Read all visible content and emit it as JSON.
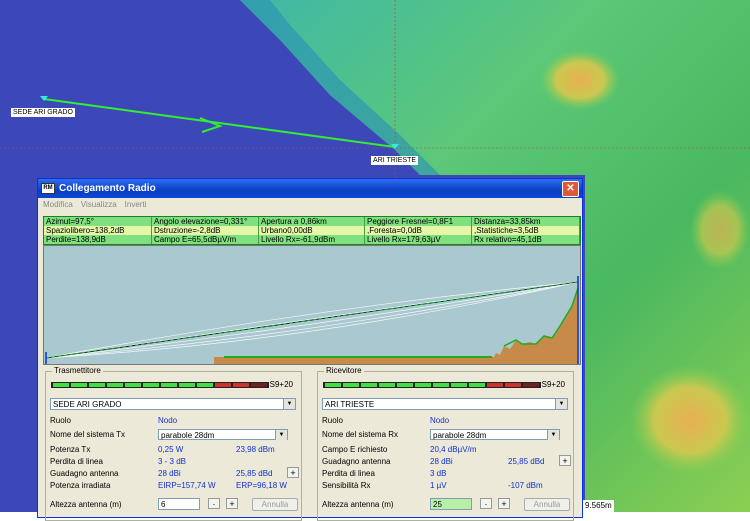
{
  "map": {
    "site_a": "SEDE ARI GRADO",
    "site_b": "ARI TRIESTE",
    "scale": "9.565m"
  },
  "dialog": {
    "title": "Collegamento Radio",
    "menu": [
      "Modifica",
      "Visualizza",
      "Inverti"
    ],
    "stats": [
      [
        "Azimut=97,5°",
        "Angolo elevazione=0,331°",
        "Apertura a 0,86km",
        "Peggiore Fresnel=0,8F1",
        "Distanza=33,85km"
      ],
      [
        "Spaziolibero=138,2dB",
        "Dstruzione=-2,8dB",
        "Urbano0,00dB",
        ",Foresta=0,0dB",
        ",Statistiche=3,5dB"
      ],
      [
        "Perdite=138,9dB",
        "Campo E=65,5dBµV/m",
        "Livello Rx=-61,9dBm",
        "Livello Rx=179,63µV",
        "Rx relativo=45,1dB"
      ]
    ],
    "tx": {
      "title": "Trasmettitore",
      "meter": "S9+20",
      "site": "SEDE ARI GRADO",
      "role_label": "Ruolo",
      "role_value": "Nodo",
      "system_label": "Nome del sistema Tx",
      "system_value": "parabole 28dm",
      "power_label": "Potenza Tx",
      "power_w": "0,25 W",
      "power_dbm": "23,98 dBm",
      "loss_label": "Perdita di linea",
      "loss_value": "3 - 3 dB",
      "gain_label": "Guadagno antenna",
      "gain_dbi": "28 dBi",
      "gain_dbd": "25,85 dBd",
      "radiated_label": "Potenza irradiata",
      "eirp": "EIRP=157,74 W",
      "erp": "ERP=96,18 W",
      "height_label": "Altezza antenna (m)",
      "height_value": "6",
      "cancel": "Annulla"
    },
    "rx": {
      "title": "Ricevitore",
      "meter": "S9+20",
      "site": "ARI TRIESTE",
      "role_label": "Ruolo",
      "role_value": "Nodo",
      "system_label": "Nome del sistema Rx",
      "system_value": "parabole 28dm",
      "field_label": "Campo E richiesto",
      "field_value": "20,4 dBµV/m",
      "gain_label": "Guadagno antenna",
      "gain_dbi": "28 dBi",
      "gain_dbd": "25,85 dBd",
      "loss_label": "Perdita di linea",
      "loss_value": "3 dB",
      "sens_label": "Sensibilità Rx",
      "sens_uv": "1 µV",
      "sens_dbm": "-107 dBm",
      "height_label": "Altezza antenna (m)",
      "height_value": "25",
      "cancel": "Annulla"
    }
  }
}
